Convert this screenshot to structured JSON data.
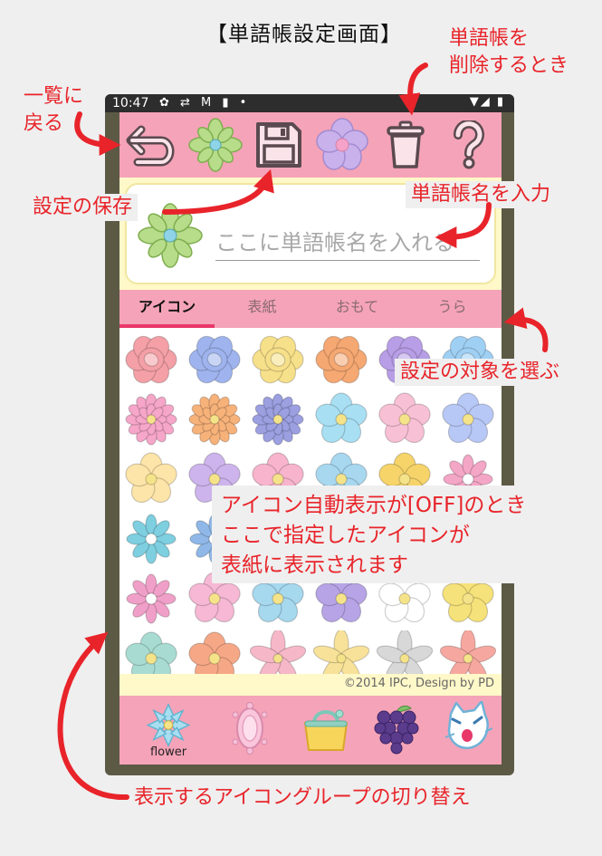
{
  "page_title": "【単語帳設定画面】",
  "status_bar": {
    "time": "10:47",
    "left_icons": "✿ ⇄ M ▮ •",
    "right_icons": "▼◢ ▮"
  },
  "toolbar": {
    "buttons": [
      {
        "name": "back",
        "icon": "undo-arrow-icon"
      },
      {
        "name": "current-icon",
        "icon": "green-jewel-flower-icon"
      },
      {
        "name": "save",
        "icon": "floppy-disk-icon"
      },
      {
        "name": "flower",
        "icon": "purple-flower-icon"
      },
      {
        "name": "delete",
        "icon": "trash-can-icon"
      },
      {
        "name": "help",
        "icon": "question-mark-icon"
      }
    ]
  },
  "name_field": {
    "placeholder": "ここに単語帳名を入れる",
    "value": ""
  },
  "tabs": [
    {
      "label": "アイコン",
      "active": true
    },
    {
      "label": "表紙",
      "active": false
    },
    {
      "label": "おもて",
      "active": false
    },
    {
      "label": "うら",
      "active": false
    }
  ],
  "copyright": "©2014 IPC, Design by PD",
  "icon_groups": [
    {
      "label": "flower",
      "icon": "jewel-flower-icon"
    },
    {
      "label": "",
      "icon": "jewel-ring-icon"
    },
    {
      "label": "",
      "icon": "handbag-icon"
    },
    {
      "label": "",
      "icon": "grapes-icon"
    },
    {
      "label": "",
      "icon": "cat-character-icon"
    }
  ],
  "annotations": {
    "back": "一覧に\n戻る",
    "delete": "単語帳を\n削除するとき",
    "save": "設定の保存",
    "name": "単語帳名を入力",
    "tabs": "設定の対象を選ぶ",
    "icon_note": "アイコン自動表示が[OFF]のとき\nここで指定したアイコンが\n表紙に表示されます",
    "groups": "表示するアイコングループの切り替え"
  },
  "colors": {
    "pink_bar": "#f5a3b8",
    "cream": "#fff8c8",
    "accent": "#e8386a",
    "annotation": "#e8242a"
  }
}
